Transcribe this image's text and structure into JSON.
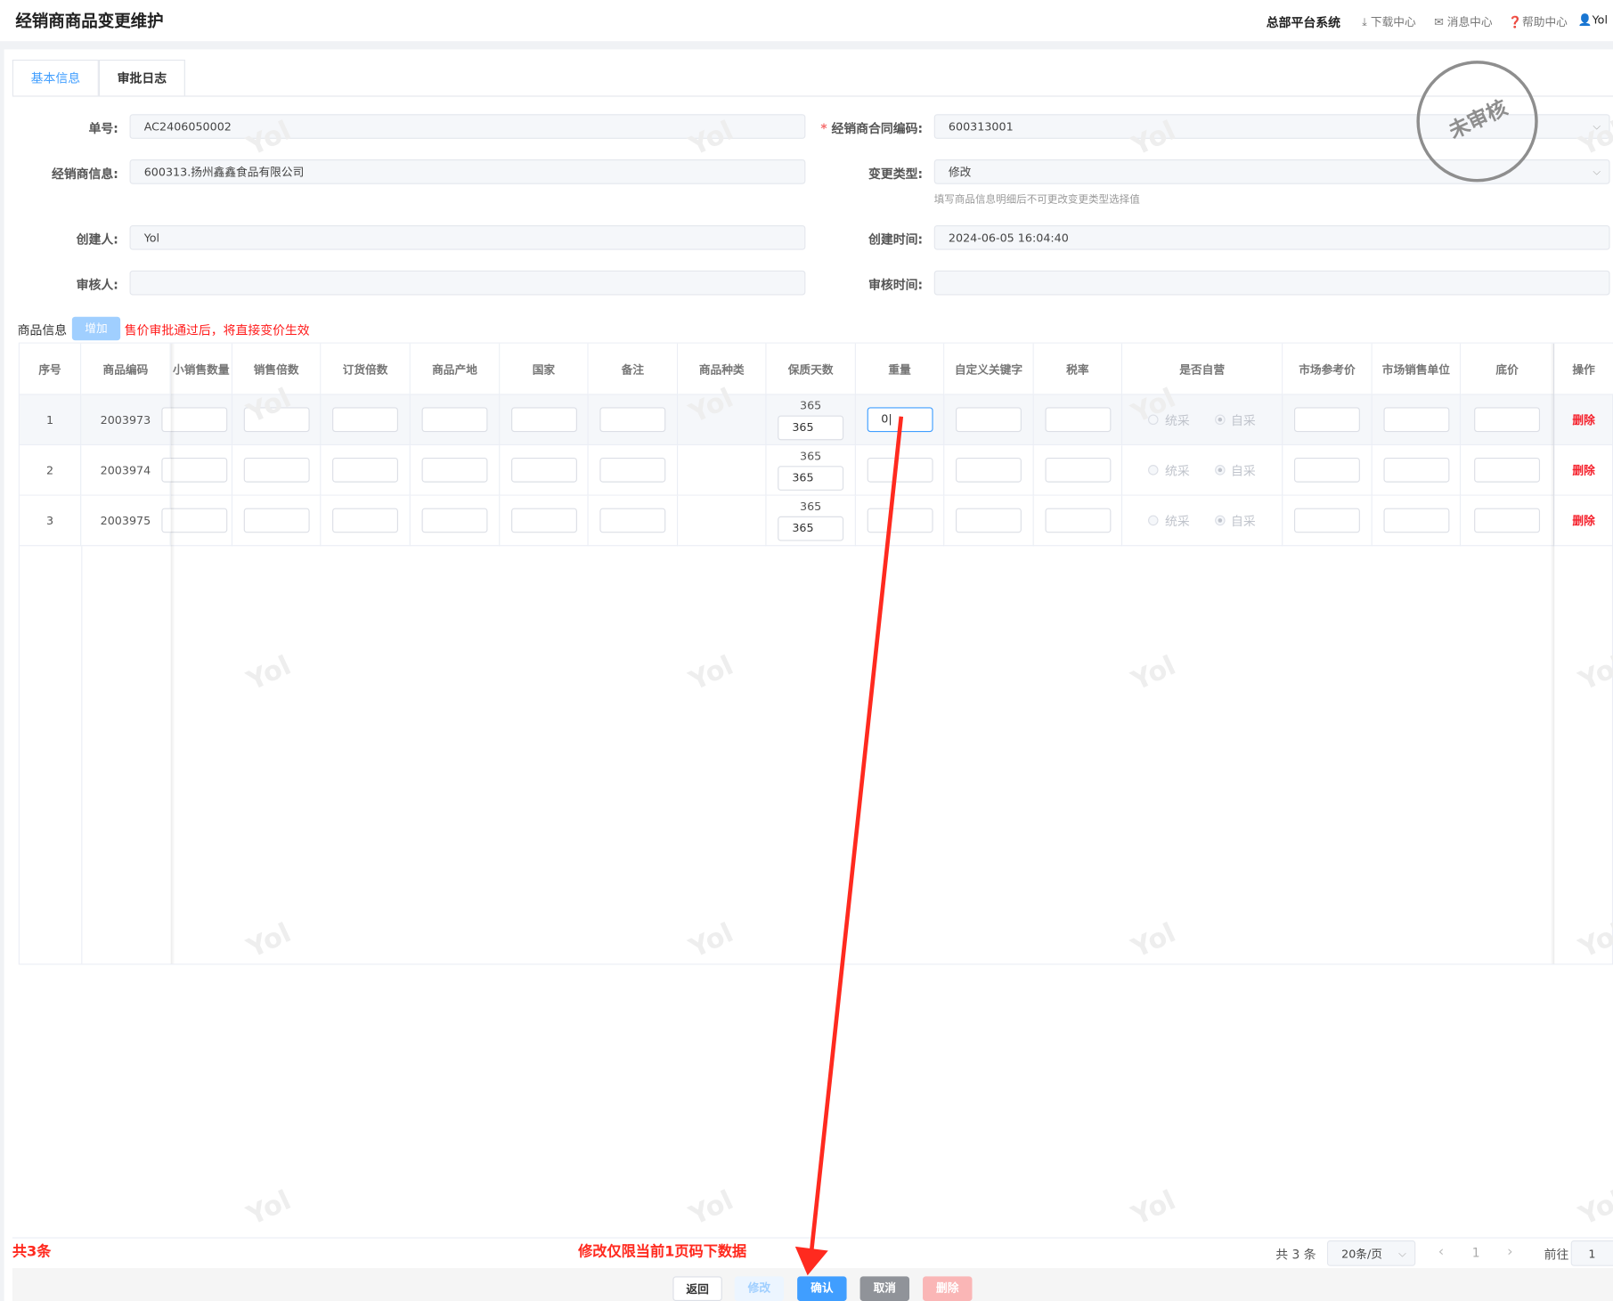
{
  "header": {
    "title": "经销商商品变更维护",
    "system": "总部平台系统",
    "download": "下载中心",
    "messages": "消息中心",
    "help": "帮助中心",
    "user": "Yol"
  },
  "tabs": [
    {
      "label": "基本信息",
      "active": true
    },
    {
      "label": "审批日志",
      "active": false
    }
  ],
  "form": {
    "order_no": {
      "label": "单号:",
      "value": "AC2406050002"
    },
    "contract_code": {
      "label": "经销商合同编码:",
      "value": "600313001",
      "required": "*"
    },
    "dealer_info": {
      "label": "经销商信息:",
      "value": "600313.扬州鑫鑫食品有限公司"
    },
    "change_type": {
      "label": "变更类型:",
      "value": "修改",
      "hint": "填写商品信息明细后不可更改变更类型选择值"
    },
    "creator": {
      "label": "创建人:",
      "value": "Yol"
    },
    "created_at": {
      "label": "创建时间:",
      "value": "2024-06-05 16:04:40"
    },
    "reviewer": {
      "label": "审核人:",
      "value": ""
    },
    "reviewed_at": {
      "label": "审核时间:",
      "value": ""
    }
  },
  "stamp": "未审核",
  "goods": {
    "label": "商品信息",
    "add_button": "增加",
    "notice": "售价审批通过后，将直接变价生效"
  },
  "table": {
    "columns": [
      "序号",
      "商品编码",
      "小销售数量",
      "销售倍数",
      "订货倍数",
      "商品产地",
      "国家",
      "备注",
      "商品种类",
      "保质天数",
      "重量",
      "自定义关键字",
      "税率",
      "是否自营",
      "市场参考价",
      "市场销售单位",
      "底价",
      "操作"
    ],
    "rows": [
      {
        "index": "1",
        "code": "2003973",
        "shelf_life": "365",
        "shelf_life_input": "365",
        "weight": "0|",
        "radio_a": "统采",
        "radio_b": "自采",
        "action": "删除"
      },
      {
        "index": "2",
        "code": "2003974",
        "shelf_life": "365",
        "shelf_life_input": "365",
        "weight": "",
        "radio_a": "统采",
        "radio_b": "自采",
        "action": "删除"
      },
      {
        "index": "3",
        "code": "2003975",
        "shelf_life": "365",
        "shelf_life_input": "365",
        "weight": "",
        "radio_a": "统采",
        "radio_b": "自采",
        "action": "删除"
      }
    ]
  },
  "watermark": "Yol",
  "footer": {
    "total_note": "共3条",
    "edit_note": "修改仅限当前1页码下数据",
    "total": "共 3 条",
    "page_size": "20条/页",
    "prev": "‹",
    "page": "1",
    "next": "›",
    "goto_label": "前往",
    "goto_value": "1"
  },
  "actions": {
    "back": "返回",
    "edit": "修改",
    "confirm": "确认",
    "cancel": "取消",
    "delete": "删除"
  },
  "colors": {
    "primary": "#409eff",
    "danger": "#f5222d",
    "annotation": "#ff2a1f"
  }
}
